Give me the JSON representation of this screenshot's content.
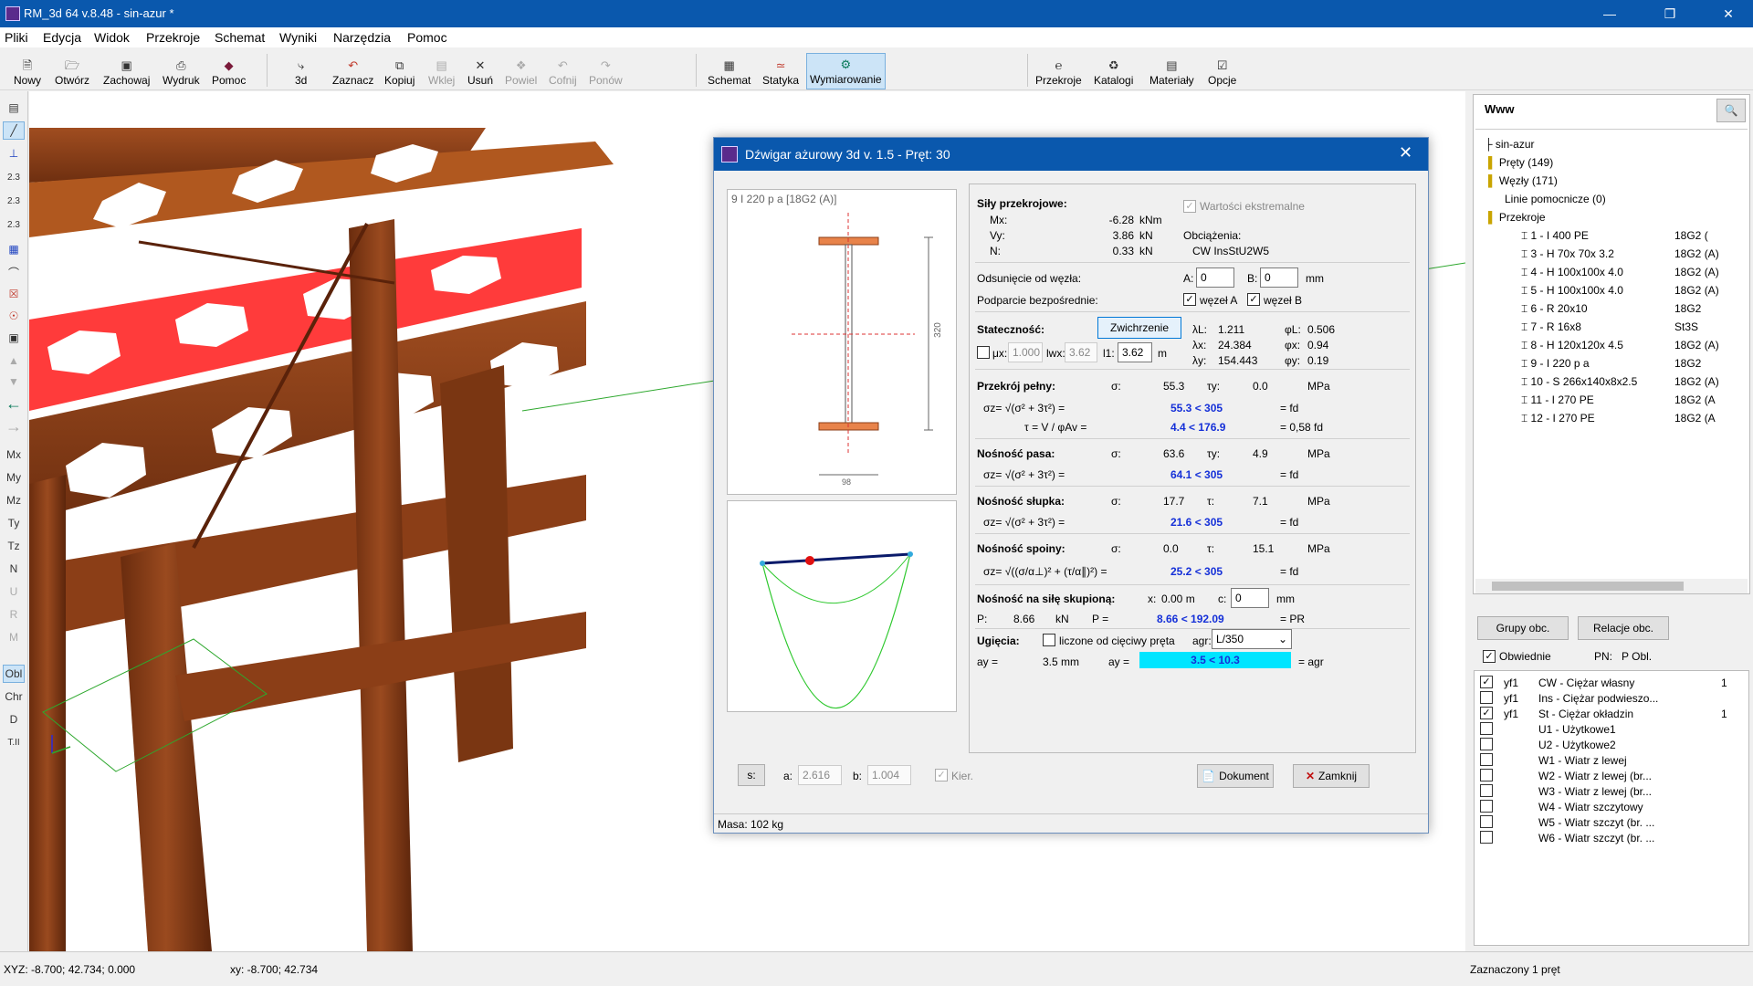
{
  "window": {
    "title": "RM_3d 64 v.8.48 - sin-azur *"
  },
  "menu": [
    "Pliki",
    "Edycja",
    "Widok",
    "Przekroje",
    "Schemat",
    "Wyniki",
    "Narzędzia",
    "Pomoc"
  ],
  "toolbar": {
    "new": "Nowy",
    "open": "Otwórz",
    "save": "Zachowaj",
    "print": "Wydruk",
    "help": "Pomoc",
    "view3d": "3d",
    "select": "Zaznacz",
    "copy": "Kopiuj",
    "paste": "Wklej",
    "delete": "Usuń",
    "repeat": "Powiel",
    "undo": "Cofnij",
    "redo": "Ponów",
    "schemat": "Schemat",
    "statyka": "Statyka",
    "wymiarowanie": "Wymiarowanie",
    "przekroje": "Przekroje",
    "katalogi": "Katalogi",
    "materialy": "Materiały",
    "opcje": "Opcje"
  },
  "lefttools": [
    "2.3",
    "2.3",
    "2.3",
    "Mx",
    "My",
    "Mz",
    "Ty",
    "Tz",
    "N",
    "U",
    "R",
    "M",
    "Obl",
    "Chr",
    "D",
    "T.II"
  ],
  "dialog": {
    "title": "Dźwigar ażurowy 3d v. 1.5 - Pręt: 30",
    "section_label": "9 I 220 p a  [18G2 (A)]",
    "dim_h": "320",
    "dim_b": "98",
    "forces": {
      "title": "Siły przekrojowe:",
      "mx_label": "Mx:",
      "mx_val": "-6.28",
      "mx_unit": "kNm",
      "vy_label": "Vy:",
      "vy_val": "3.86",
      "vy_unit": "kN",
      "n_label": "N:",
      "n_val": "0.33",
      "n_unit": "kN",
      "extreme_label": "Wartości ekstremalne",
      "loads_label": "Obciążenia:",
      "loads_val": "CW InsStU2W5"
    },
    "offset": {
      "label": "Odsunięcie od węzła:",
      "a_label": "A:",
      "a_val": "0",
      "b_label": "B:",
      "b_val": "0",
      "unit": "mm",
      "support_label": "Podparcie bezpośrednie:",
      "nodeA": "węzeł A",
      "nodeB": "węzeł B"
    },
    "stability": {
      "label": "Stateczność:",
      "button": "Zwichrzenie",
      "lam_l": "1.211",
      "phi_l": "0.506",
      "lam_x": "24.384",
      "phi_x": "0.94",
      "lam_y": "154.443",
      "phi_y": "0.19",
      "mu_label": "μx:",
      "mu_val": "1.000",
      "lwx_label": "lwx:",
      "lwx_val": "3.62",
      "l1_label": "l1:",
      "l1_val": "3.62",
      "l1_unit": "m"
    },
    "full": {
      "label": "Przekrój pełny:",
      "sigma": "55.3",
      "tau": "0.0",
      "unit": "MPa",
      "check": "55.3 < 305",
      "fd": "= fd",
      "tau_formula": "τ = V / φAv =",
      "tau_check": "4.4 < 176.9",
      "tau_fd": "= 0,58 fd"
    },
    "flange": {
      "label": "Nośność pasa:",
      "sigma": "63.6",
      "tau": "4.9",
      "unit": "MPa",
      "check": "64.1 < 305",
      "fd": "= fd"
    },
    "post": {
      "label": "Nośność słupka:",
      "sigma": "17.7",
      "tau": "7.1",
      "unit": "MPa",
      "check": "21.6 < 305",
      "fd": "= fd"
    },
    "weld": {
      "label": "Nośność spoiny:",
      "sigma": "0.0",
      "tau": "15.1",
      "unit": "MPa",
      "check": "25.2 < 305",
      "fd": "= fd"
    },
    "conc": {
      "label": "Nośność na siłę skupioną:",
      "x_label": "x:",
      "x_val": "0.00 m",
      "c_label": "c:",
      "c_val": "0",
      "c_unit": "mm",
      "p_label": "P:",
      "p_val": "8.66",
      "p_unit": "kN",
      "pc_label": "P =",
      "pc_check": "8.66 < 192.09",
      "pr": "= PR"
    },
    "defl": {
      "label": "Ugięcia:",
      "chord_label": "liczone od cięciwy pręta",
      "agr_label": "agr:",
      "agr_val": "L/350",
      "ay_label": "ay =",
      "ay_val": "3.5 mm",
      "ay2_label": "ay =",
      "ay_check": "3.5 < 10.3",
      "agr_eq": "= agr"
    },
    "bottom": {
      "s_button": "s:",
      "a_label": "a:",
      "a_val": "2.616",
      "b_label": "b:",
      "b_val": "1.004",
      "dir_label": "Kier.",
      "doc_button": "Dokument",
      "close_button": "Zamknij",
      "mass": "Masa: 102 kg"
    }
  },
  "tree": {
    "header": "Www",
    "root": "sin-azur",
    "items": [
      "Pręty (149)",
      "Węzły (171)",
      "Linie pomocnicze (0)",
      "Przekroje"
    ],
    "sections": [
      {
        "name": "1 - I 400 PE",
        "mat": "18G2 ("
      },
      {
        "name": "3 - H 70x 70x 3.2",
        "mat": "18G2 (A)"
      },
      {
        "name": "4 - H 100x100x 4.0",
        "mat": "18G2 (A)"
      },
      {
        "name": "5 - H 100x100x 4.0",
        "mat": "18G2 (A)"
      },
      {
        "name": "6 - R 20x10",
        "mat": "18G2"
      },
      {
        "name": "7 - R 16x8",
        "mat": "St3S"
      },
      {
        "name": "8 - H 120x120x 4.5",
        "mat": "18G2 (A)"
      },
      {
        "name": "9 - I 220 p a",
        "mat": "18G2"
      },
      {
        "name": "10 - S 266x140x8x2.5",
        "mat": "18G2 (A)"
      },
      {
        "name": "11 - I 270 PE",
        "mat": "18G2 (A"
      },
      {
        "name": "12 - I 270 PE",
        "mat": "18G2 (A"
      }
    ]
  },
  "loads": {
    "groups_button": "Grupy obc.",
    "relations_button": "Relacje obc.",
    "required_label": "Obwiednie",
    "pn_label": "PN:",
    "pn_val": "P Obl.",
    "rows": [
      {
        "checked": true,
        "code": "yf1",
        "name": "CW - Ciężar własny",
        "n": "1"
      },
      {
        "checked": false,
        "code": "yf1",
        "name": "Ins - Ciężar podwieszo...",
        "n": ""
      },
      {
        "checked": true,
        "code": "yf1",
        "name": "St - Ciężar okładzin",
        "n": "1"
      },
      {
        "checked": false,
        "code": "",
        "name": "U1 - Użytkowe1",
        "n": ""
      },
      {
        "checked": false,
        "code": "",
        "name": "U2 - Użytkowe2",
        "n": ""
      },
      {
        "checked": false,
        "code": "",
        "name": "W1 - Wiatr z lewej",
        "n": ""
      },
      {
        "checked": false,
        "code": "",
        "name": "W2 - Wiatr z lewej (br...",
        "n": ""
      },
      {
        "checked": false,
        "code": "",
        "name": "W3 - Wiatr z lewej (br...",
        "n": ""
      },
      {
        "checked": false,
        "code": "",
        "name": "W4 - Wiatr szczytowy",
        "n": ""
      },
      {
        "checked": false,
        "code": "",
        "name": "W5 - Wiatr szczyt (br. ...",
        "n": ""
      },
      {
        "checked": false,
        "code": "",
        "name": "W6 - Wiatr szczyt (br. ...",
        "n": ""
      }
    ]
  },
  "status": {
    "xyz": "XYZ: -8.700; 42.734; 0.000",
    "xy": "xy: -8.700; 42.734",
    "selection": "Zaznaczony 1 pręt"
  },
  "colors": {
    "title_bar": "#0a58ad",
    "steel": "#8b3e17",
    "highlight": "#ff3b3b",
    "check_bar": "#00e5ff"
  }
}
